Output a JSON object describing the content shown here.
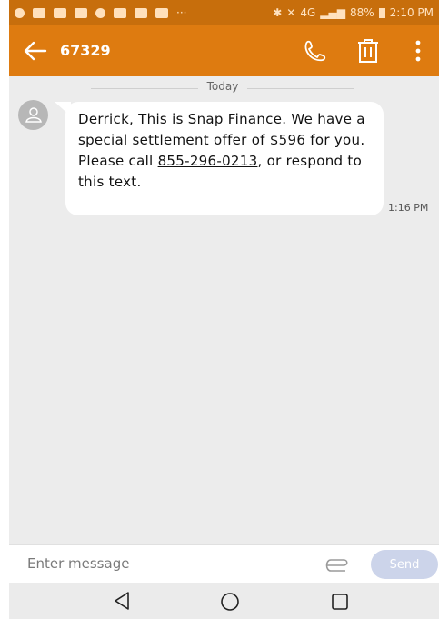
{
  "status_bar": {
    "battery": "88%",
    "time": "2:10 PM",
    "signal": "4G"
  },
  "app_bar": {
    "contact": "67329",
    "icons": [
      "back-arrow-icon",
      "phone-icon",
      "trash-icon",
      "more-vert-icon"
    ]
  },
  "conversation": {
    "date_divider": "Today",
    "message": {
      "text_before_link": "Derrick, This is Snap Finance. We have a special settlement offer of $596 for you. Please call ",
      "phone_link": "855-296-0213",
      "text_after_link": ", or respond to this text.",
      "time": "1:16 PM"
    }
  },
  "compose": {
    "placeholder": "Enter message",
    "send_label": "Send"
  },
  "nav_bar": {
    "icons": [
      "back-triangle-icon",
      "home-circle-icon",
      "recents-square-icon"
    ]
  },
  "colors": {
    "status_bar": "#c76e0c",
    "app_bar": "#de7b10",
    "send_button": "#ccd4ea"
  }
}
